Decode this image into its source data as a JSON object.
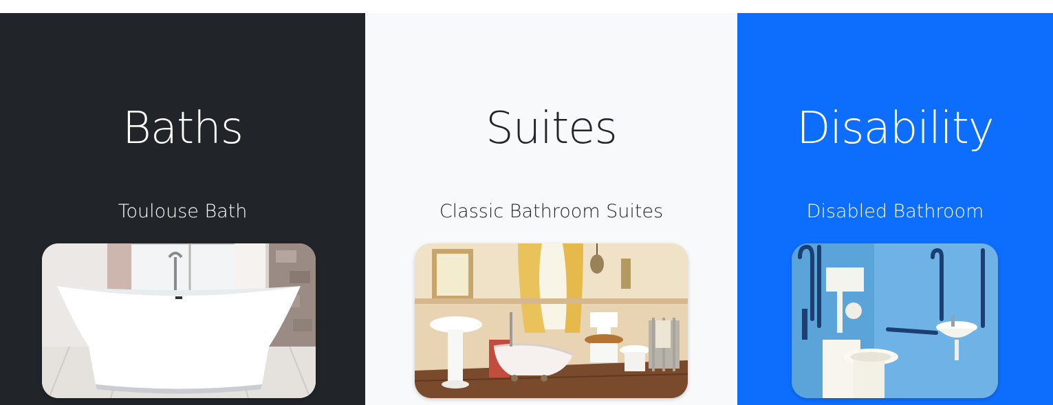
{
  "categories": [
    {
      "title": "Baths",
      "subtitle": "Toulouse Bath",
      "image_description": "freestanding white roll-top bath",
      "background": "#212529"
    },
    {
      "title": "Suites",
      "subtitle": "Classic Bathroom Suites",
      "image_description": "classic bathroom suite with clawfoot bath, pedestal basin, toilet and bidet",
      "background": "#f8f9fa"
    },
    {
      "title": "Disability",
      "subtitle": "Disabled Bathroom",
      "image_description": "disabled bathroom with grab rails, toilet and basin",
      "background": "#0d6efd"
    }
  ]
}
